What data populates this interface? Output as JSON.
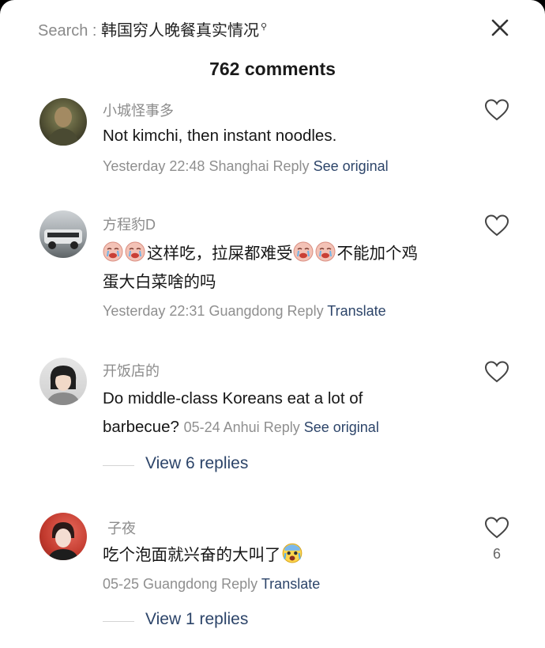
{
  "header": {
    "search_label": "Search : ",
    "search_query": "韩国穷人晚餐真实情况",
    "search_icon": "search-icon",
    "close_icon": "close-icon",
    "comments_count": "762 comments"
  },
  "comments": [
    {
      "username": "小城怪事多",
      "text": "Not kimchi, then instant noodles.",
      "meta_time": "Yesterday 22:48 Shanghai",
      "reply": "Reply",
      "action": "See original"
    },
    {
      "username": "方程豹D",
      "text_part1": "这样吃，拉屎都难受",
      "text_part2": "不能加个鸡",
      "text_line2": "蛋大白菜啥的吗",
      "meta_time": "Yesterday 22:31 Guangdong",
      "reply": "Reply",
      "action": "Translate"
    },
    {
      "username": "开饭店的",
      "text_line1": "Do middle-class Koreans eat a lot of",
      "text_line2": "barbecue?",
      "meta_time": "05-24 Anhui",
      "reply": "Reply",
      "action": "See original",
      "view_replies": "View 6 replies"
    },
    {
      "username": "子夜",
      "text": "吃个泡面就兴奋的大叫了",
      "meta_time": "05-25 Guangdong",
      "reply": "Reply",
      "action": "Translate",
      "likes": "6",
      "view_replies": "View 1 replies"
    }
  ],
  "icons": {
    "like": "heart-icon",
    "crying_emoji": "crying-face-emoji",
    "scared_emoji": "scared-face-emoji"
  },
  "colors": {
    "link": "#2c4469",
    "meta": "#8f8f8f",
    "username": "#8c8c8c"
  }
}
